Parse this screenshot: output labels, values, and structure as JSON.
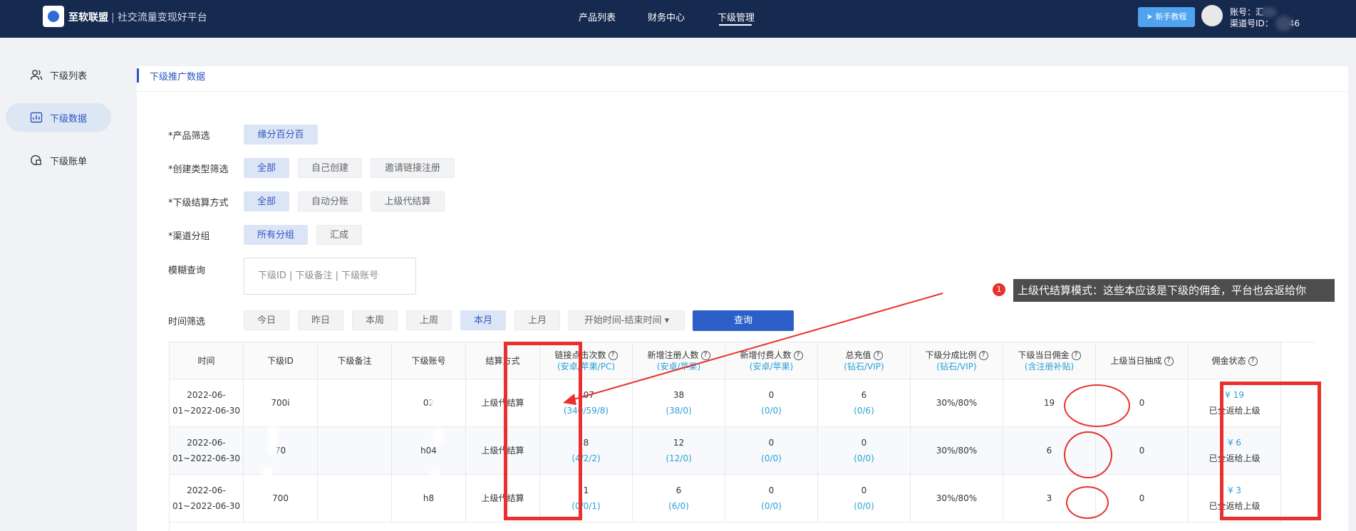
{
  "topbar": {
    "brand_name": "至软联盟",
    "brand_sep": "|",
    "brand_slogan": "社交流量变现好平台",
    "nav": [
      "产品列表",
      "财务中心",
      "下级管理"
    ],
    "help_button": "新手教程",
    "account_line": "账号：汇",
    "channel_line": "渠道号ID：",
    "channel_tail": "46"
  },
  "sidebar": {
    "items": [
      {
        "label": "下级列表",
        "icon": "users-icon"
      },
      {
        "label": "下级数据",
        "icon": "chart-icon"
      },
      {
        "label": "下级账单",
        "icon": "bill-icon"
      }
    ]
  },
  "panel": {
    "title": "下级推广数据"
  },
  "filters": {
    "product_label": "*产品筛选",
    "product_options": [
      "缘分百分百"
    ],
    "create_type_label": "*创建类型筛选",
    "create_type_options": [
      "全部",
      "自己创建",
      "邀请链接注册"
    ],
    "settle_label": "*下级结算方式",
    "settle_options": [
      "全部",
      "自动分账",
      "上级代结算"
    ],
    "group_label": "*渠道分组",
    "group_options": [
      "所有分组",
      "汇成"
    ],
    "fuzzy_label": "模糊查询",
    "fuzzy_placeholder": "下级ID | 下级备注 | 下级账号",
    "time_label": "时间筛选",
    "time_options": [
      "今日",
      "昨日",
      "本周",
      "上周",
      "本月",
      "上月"
    ],
    "time_range": "开始时间-结束时间 ▾",
    "query_button": "查询"
  },
  "annotation": {
    "number": "1",
    "text": "上级代结算模式：这些本应该是下级的佣金，平台也会返给你"
  },
  "table": {
    "headers": [
      {
        "title": "时间"
      },
      {
        "title": "下级ID"
      },
      {
        "title": "下级备注"
      },
      {
        "title": "下级账号"
      },
      {
        "title": "结算方式"
      },
      {
        "title": "链接点击次数",
        "sub": "(安卓/苹果/PC)",
        "help": "?"
      },
      {
        "title": "新增注册人数",
        "sub": "(安卓/苹果)",
        "help": "?"
      },
      {
        "title": "新增付费人数",
        "sub": "(安卓/苹果)",
        "help": "?"
      },
      {
        "title": "总充值",
        "sub": "(钻石/VIP)",
        "help": "?"
      },
      {
        "title": "下级分成比例",
        "sub": "(钻石/VIP)",
        "help": "?"
      },
      {
        "title": "下级当日佣金",
        "sub": "(含注册补贴)",
        "help": "?"
      },
      {
        "title": "上级当日抽成",
        "help": "?"
      },
      {
        "title": "佣金状态",
        "help": "?"
      }
    ],
    "rows": [
      {
        "time_a": "2022-06-",
        "time_b": "01~2022-06-30",
        "id": "700",
        "id_tail": "i",
        "note": "",
        "account": "02",
        "settle": "上级代结算",
        "clicks": "407",
        "clicks_sub": "(340/59/8)",
        "reg": "38",
        "reg_sub": "(38/0)",
        "paid": "0",
        "paid_sub": "(0/0)",
        "recharge": "6",
        "recharge_sub": "(0/6)",
        "ratio": "30%/80%",
        "commission": "19",
        "extract": "0",
        "status_amount": "¥ 19",
        "status_text": "已全返给上级"
      },
      {
        "time_a": "2022-06-",
        "time_b": "01~2022-06-30",
        "id": "70",
        "id_tail": "",
        "note": "",
        "account": "h",
        "account_tail": "04",
        "settle": "上级代结算",
        "clicks": "8",
        "clicks_sub": "(4/2/2)",
        "reg": "12",
        "reg_sub": "(12/0)",
        "paid": "0",
        "paid_sub": "(0/0)",
        "recharge": "0",
        "recharge_sub": "(0/0)",
        "ratio": "30%/80%",
        "commission": "6",
        "extract": "0",
        "status_amount": "¥ 6",
        "status_text": "已全返给上级"
      },
      {
        "time_a": "2022-06-",
        "time_b": "01~2022-06-30",
        "id": "700",
        "id_tail": "",
        "note": "",
        "account": "h",
        "account_tail": "8",
        "settle": "上级代结算",
        "clicks": "1",
        "clicks_sub": "(0/0/1)",
        "reg": "6",
        "reg_sub": "(6/0)",
        "paid": "0",
        "paid_sub": "(0/0)",
        "recharge": "0",
        "recharge_sub": "(0/0)",
        "ratio": "30%/80%",
        "commission": "3",
        "extract": "0",
        "status_amount": "¥ 3",
        "status_text": "已全返给上级"
      }
    ]
  },
  "colors": {
    "topbar": "#16294f",
    "accent": "#2d56c4",
    "highlight": "#e8312f",
    "sub_text": "#2aa0d6"
  }
}
